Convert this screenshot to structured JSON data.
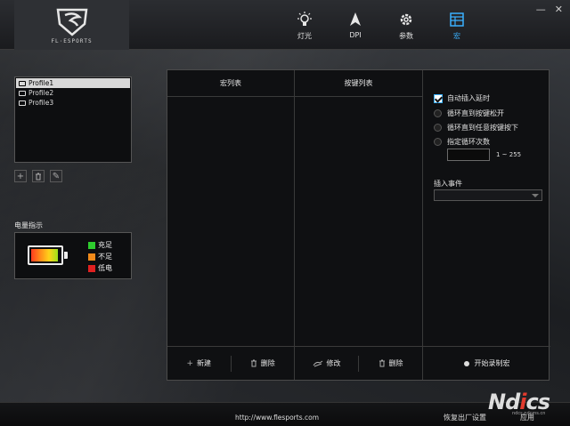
{
  "brand": {
    "logo_text": "FL·ESPORTS"
  },
  "nav": [
    {
      "label": "灯光",
      "icon": "light-bulb-icon"
    },
    {
      "label": "DPI",
      "icon": "cursor-arrow-icon"
    },
    {
      "label": "参数",
      "icon": "gear-icon"
    },
    {
      "label": "宏",
      "icon": "macro-grid-icon",
      "active": true
    }
  ],
  "window": {
    "minimize": "—",
    "close": "✕"
  },
  "profiles": [
    "Profile1",
    "Profile2",
    "Profile3"
  ],
  "profile_tools": {
    "add": "+",
    "delete": "🗑",
    "edit": "✎"
  },
  "battery": {
    "label": "电量指示",
    "level": 0.95,
    "legend": [
      {
        "label": "充足",
        "color": "#2ecc2e"
      },
      {
        "label": "不足",
        "color": "#f08a1a"
      },
      {
        "label": "低电",
        "color": "#e02020"
      }
    ]
  },
  "macro_list": {
    "header": "宏列表",
    "new_label": "新建",
    "delete_label": "删除"
  },
  "key_list": {
    "header": "按键列表",
    "modify_label": "修改",
    "delete_label": "删除"
  },
  "options": {
    "auto_delay": "自动插入延时",
    "loop_until_release": "循环直到按键松开",
    "loop_until_any_key": "循环直到任意按键按下",
    "loop_count": "指定循环次数",
    "loop_count_value": "",
    "range": "1 ~ 255",
    "insert_event_label": "插入事件",
    "insert_event_value": "",
    "record_label": "开始录制宏"
  },
  "footer": {
    "url": "http://www.flesports.com",
    "reset": "恢复出厂设置",
    "apply": "应用"
  },
  "watermark": {
    "text": "Nd",
    "text_red": "i",
    "text2": "cs",
    "url": "ndcs.ndcms.cn"
  }
}
